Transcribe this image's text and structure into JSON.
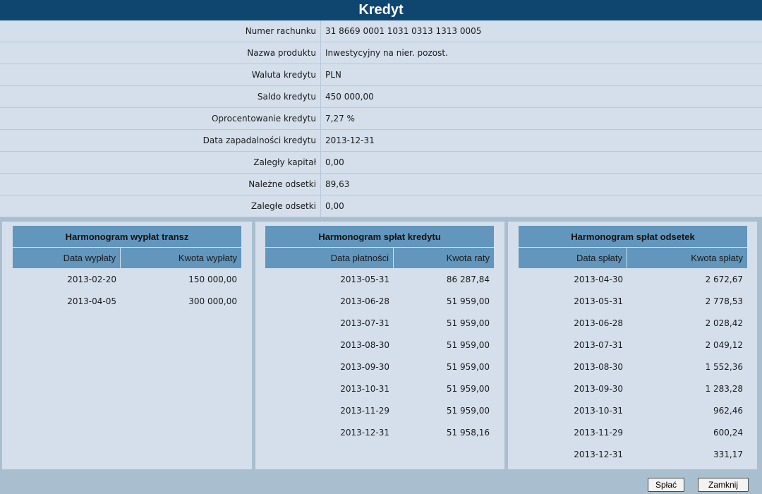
{
  "window": {
    "title": "Kredyt"
  },
  "details": [
    {
      "label": "Numer rachunku",
      "value": "31 8669 0001 1031 0313 1313 0005"
    },
    {
      "label": "Nazwa produktu",
      "value": "Inwestycyjny na nier. pozost."
    },
    {
      "label": "Waluta kredytu",
      "value": "PLN"
    },
    {
      "label": "Saldo kredytu",
      "value": "450 000,00"
    },
    {
      "label": "Oprocentowanie kredytu",
      "value": "7,27 %"
    },
    {
      "label": "Data zapadalności kredytu",
      "value": "2013-12-31"
    },
    {
      "label": "Zaległy kapitał",
      "value": "0,00"
    },
    {
      "label": "Należne odsetki",
      "value": "89,63"
    },
    {
      "label": "Zaległe odsetki",
      "value": "0,00"
    }
  ],
  "schedules": [
    {
      "title": "Harmonogram wypłat transz",
      "col1": "Data wypłaty",
      "col2": "Kwota wypłaty",
      "rows": [
        [
          "2013-02-20",
          "150 000,00"
        ],
        [
          "2013-04-05",
          "300 000,00"
        ]
      ]
    },
    {
      "title": "Harmonogram spłat kredytu",
      "col1": "Data płatności",
      "col2": "Kwota raty",
      "rows": [
        [
          "2013-05-31",
          "86 287,84"
        ],
        [
          "2013-06-28",
          "51 959,00"
        ],
        [
          "2013-07-31",
          "51 959,00"
        ],
        [
          "2013-08-30",
          "51 959,00"
        ],
        [
          "2013-09-30",
          "51 959,00"
        ],
        [
          "2013-10-31",
          "51 959,00"
        ],
        [
          "2013-11-29",
          "51 959,00"
        ],
        [
          "2013-12-31",
          "51 958,16"
        ]
      ]
    },
    {
      "title": "Harmonogram spłat odsetek",
      "col1": "Data spłaty",
      "col2": "Kwota spłaty",
      "rows": [
        [
          "2013-04-30",
          "2 672,67"
        ],
        [
          "2013-05-31",
          "2 778,53"
        ],
        [
          "2013-06-28",
          "2 028,42"
        ],
        [
          "2013-07-31",
          "2 049,12"
        ],
        [
          "2013-08-30",
          "1 552,36"
        ],
        [
          "2013-09-30",
          "1 283,28"
        ],
        [
          "2013-10-31",
          "962,46"
        ],
        [
          "2013-11-29",
          "600,24"
        ],
        [
          "2013-12-31",
          "331,17"
        ]
      ]
    }
  ],
  "buttons": {
    "pay": "Spłać",
    "close": "Zamknij"
  },
  "colors": {
    "title_bar": "#0e4670",
    "panel_bg": "#d4dfeb",
    "header_bg": "#6296bc",
    "page_bg": "#a9bfcf"
  }
}
